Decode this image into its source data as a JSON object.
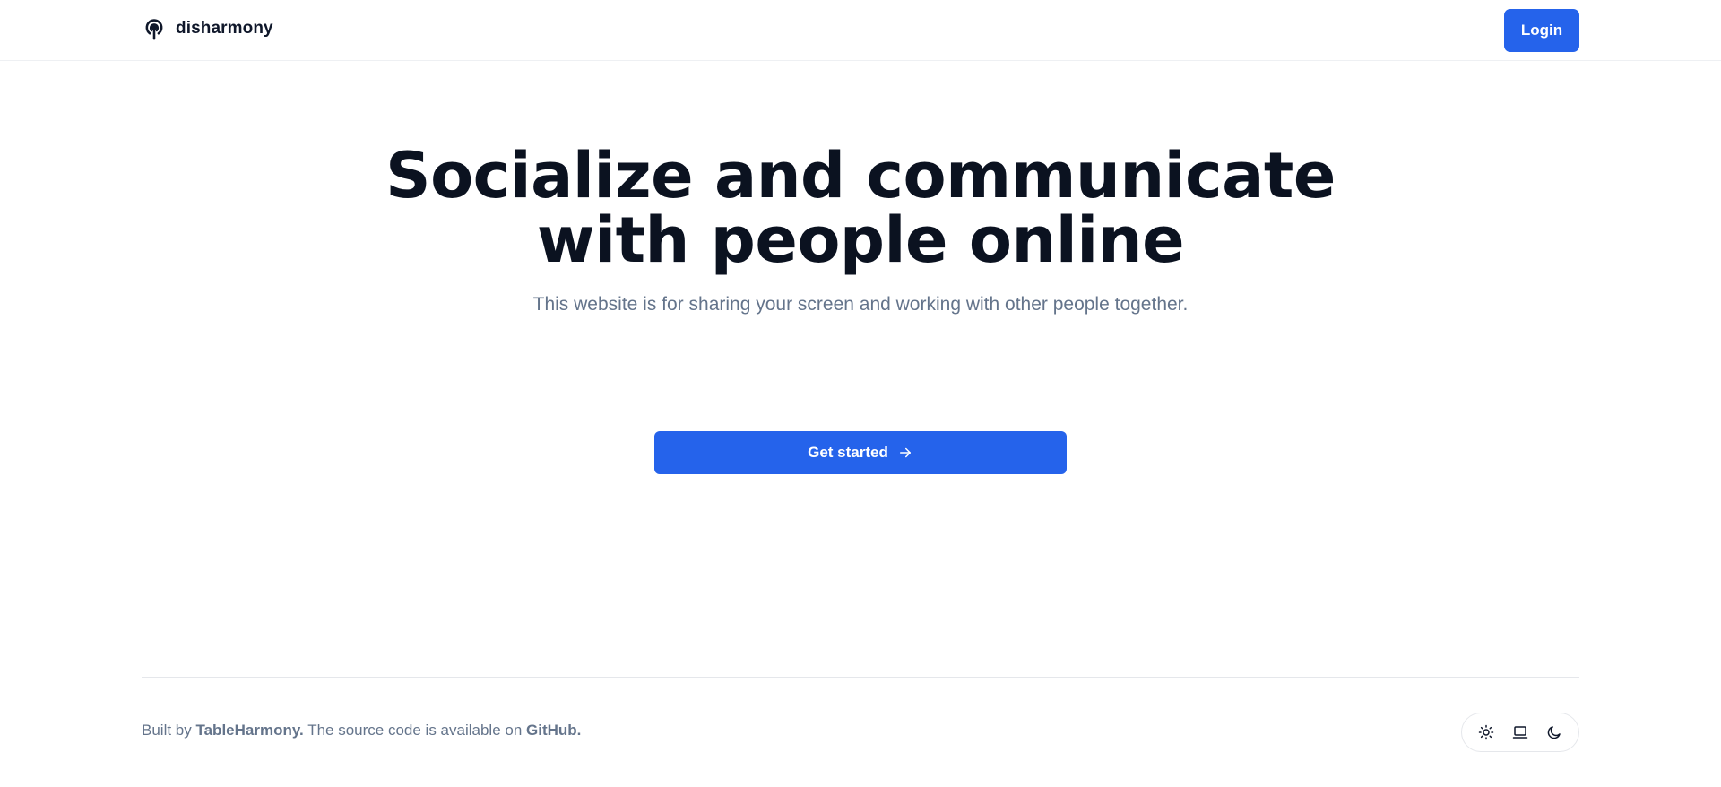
{
  "header": {
    "brand_name": "disharmony",
    "brand_icon": "podcast-icon",
    "login_label": "Login"
  },
  "hero": {
    "headline_line1": "Socialize and communicate",
    "headline_line2": "with people online",
    "subtitle": "This website is for sharing your screen and working with other people together.",
    "cta_label": "Get started",
    "cta_icon": "arrow-right-icon"
  },
  "footer": {
    "built_by_prefix": "Built by",
    "author_link": "TableHarmony.",
    "source_text": "The source code is available on",
    "github_link": "GitHub.",
    "theme_buttons": [
      "sun-icon",
      "laptop-icon",
      "moon-icon"
    ]
  },
  "colors": {
    "accent": "#2563eb",
    "text_primary": "#0b1220",
    "text_muted": "#64748b",
    "border": "#e5e7eb"
  }
}
